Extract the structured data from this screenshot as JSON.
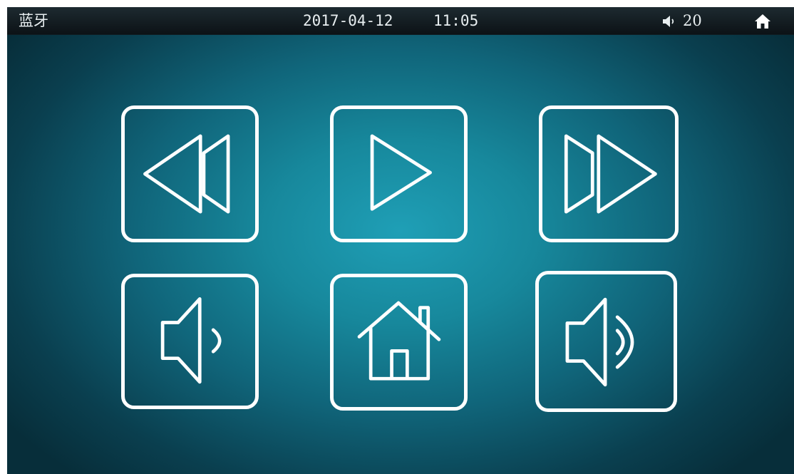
{
  "status_bar": {
    "title": "蓝牙",
    "date": "2017-04-12",
    "time": "11:05",
    "volume": "20",
    "volume_icon": "speaker-icon",
    "home_icon": "home-icon"
  },
  "controls": [
    {
      "id": "rewind",
      "icon": "rewind-icon"
    },
    {
      "id": "play",
      "icon": "play-icon"
    },
    {
      "id": "fast-forward",
      "icon": "fast-forward-icon"
    },
    {
      "id": "volume-down",
      "icon": "volume-down-icon"
    },
    {
      "id": "home",
      "icon": "home-icon"
    },
    {
      "id": "volume-up",
      "icon": "volume-up-icon"
    }
  ],
  "colors": {
    "background_center": "#1f9fb6",
    "background_edge": "#072e3a",
    "status_bar": "#10181c",
    "icon": "#ffffff"
  }
}
